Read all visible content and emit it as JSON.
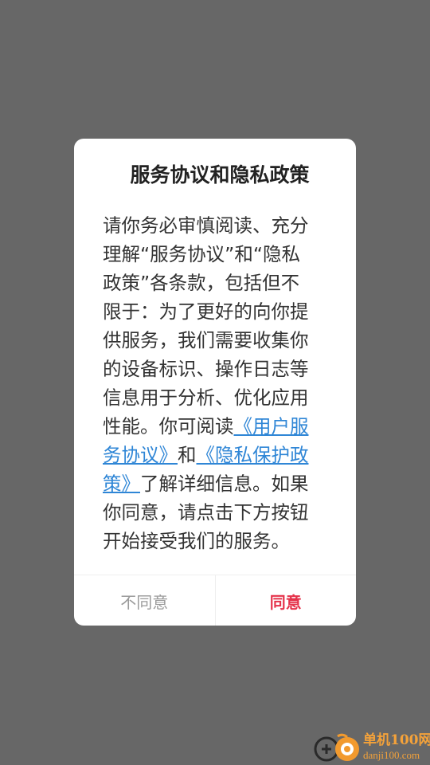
{
  "dialog": {
    "title": "服务协议和隐私政策",
    "body_prefix": "请你务必审慎阅读、充分理解“服务协议”和“隐私政策”各条款，包括但不限于：为了更好的向你提供服务，我们需要收集你的设备标识、操作日志等信息用于分析、优化应用性能。你可阅读",
    "link_user_agreement": "《用户服务协议》",
    "body_and": "和",
    "link_privacy_policy": "《隐私保护政策》",
    "body_suffix": "了解详细信息。如果你同意，请点击下方按钮开始接受我们的服务。",
    "disagree_label": "不同意",
    "agree_label": "同意"
  },
  "watermark": {
    "name_cn": "单机100网",
    "domain": "danji100.com"
  },
  "colors": {
    "overlay": "#676767",
    "link": "#2f86d6",
    "agree": "#e5334b",
    "disagree": "#9a9a9a",
    "watermark": "#f4a23a"
  }
}
